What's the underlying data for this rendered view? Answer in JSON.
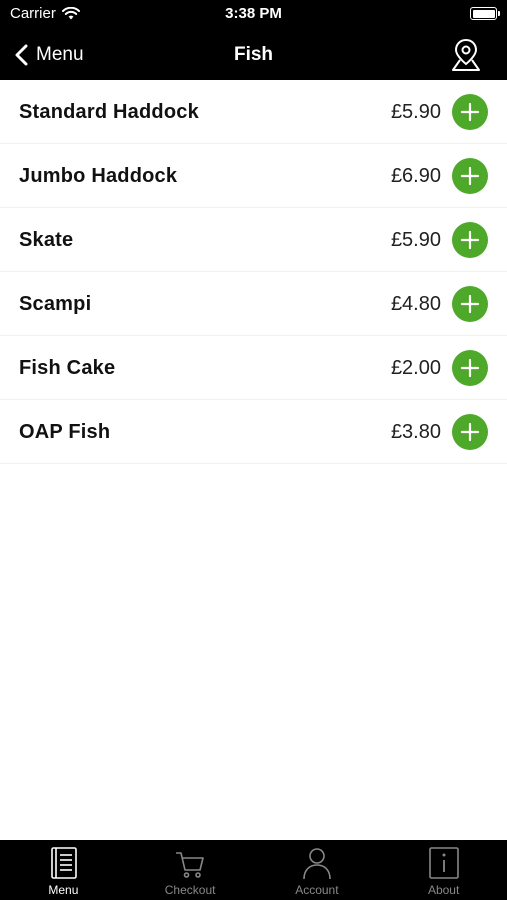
{
  "status_bar": {
    "carrier": "Carrier",
    "time": "3:38 PM"
  },
  "nav": {
    "back_label": "Menu",
    "title": "Fish"
  },
  "items": [
    {
      "name": "Standard Haddock",
      "price": "£5.90"
    },
    {
      "name": "Jumbo Haddock",
      "price": "£6.90"
    },
    {
      "name": "Skate",
      "price": "£5.90"
    },
    {
      "name": "Scampi",
      "price": "£4.80"
    },
    {
      "name": "Fish Cake",
      "price": "£2.00"
    },
    {
      "name": "OAP Fish",
      "price": "£3.80"
    }
  ],
  "tabs": [
    {
      "label": "Menu",
      "icon": "menu-book-icon",
      "active": true
    },
    {
      "label": "Checkout",
      "icon": "cart-icon",
      "active": false
    },
    {
      "label": "Account",
      "icon": "user-icon",
      "active": false
    },
    {
      "label": "About",
      "icon": "info-icon",
      "active": false
    }
  ],
  "colors": {
    "accent": "#4ea82a",
    "bar": "#000000",
    "inactive_tab": "#888888"
  }
}
